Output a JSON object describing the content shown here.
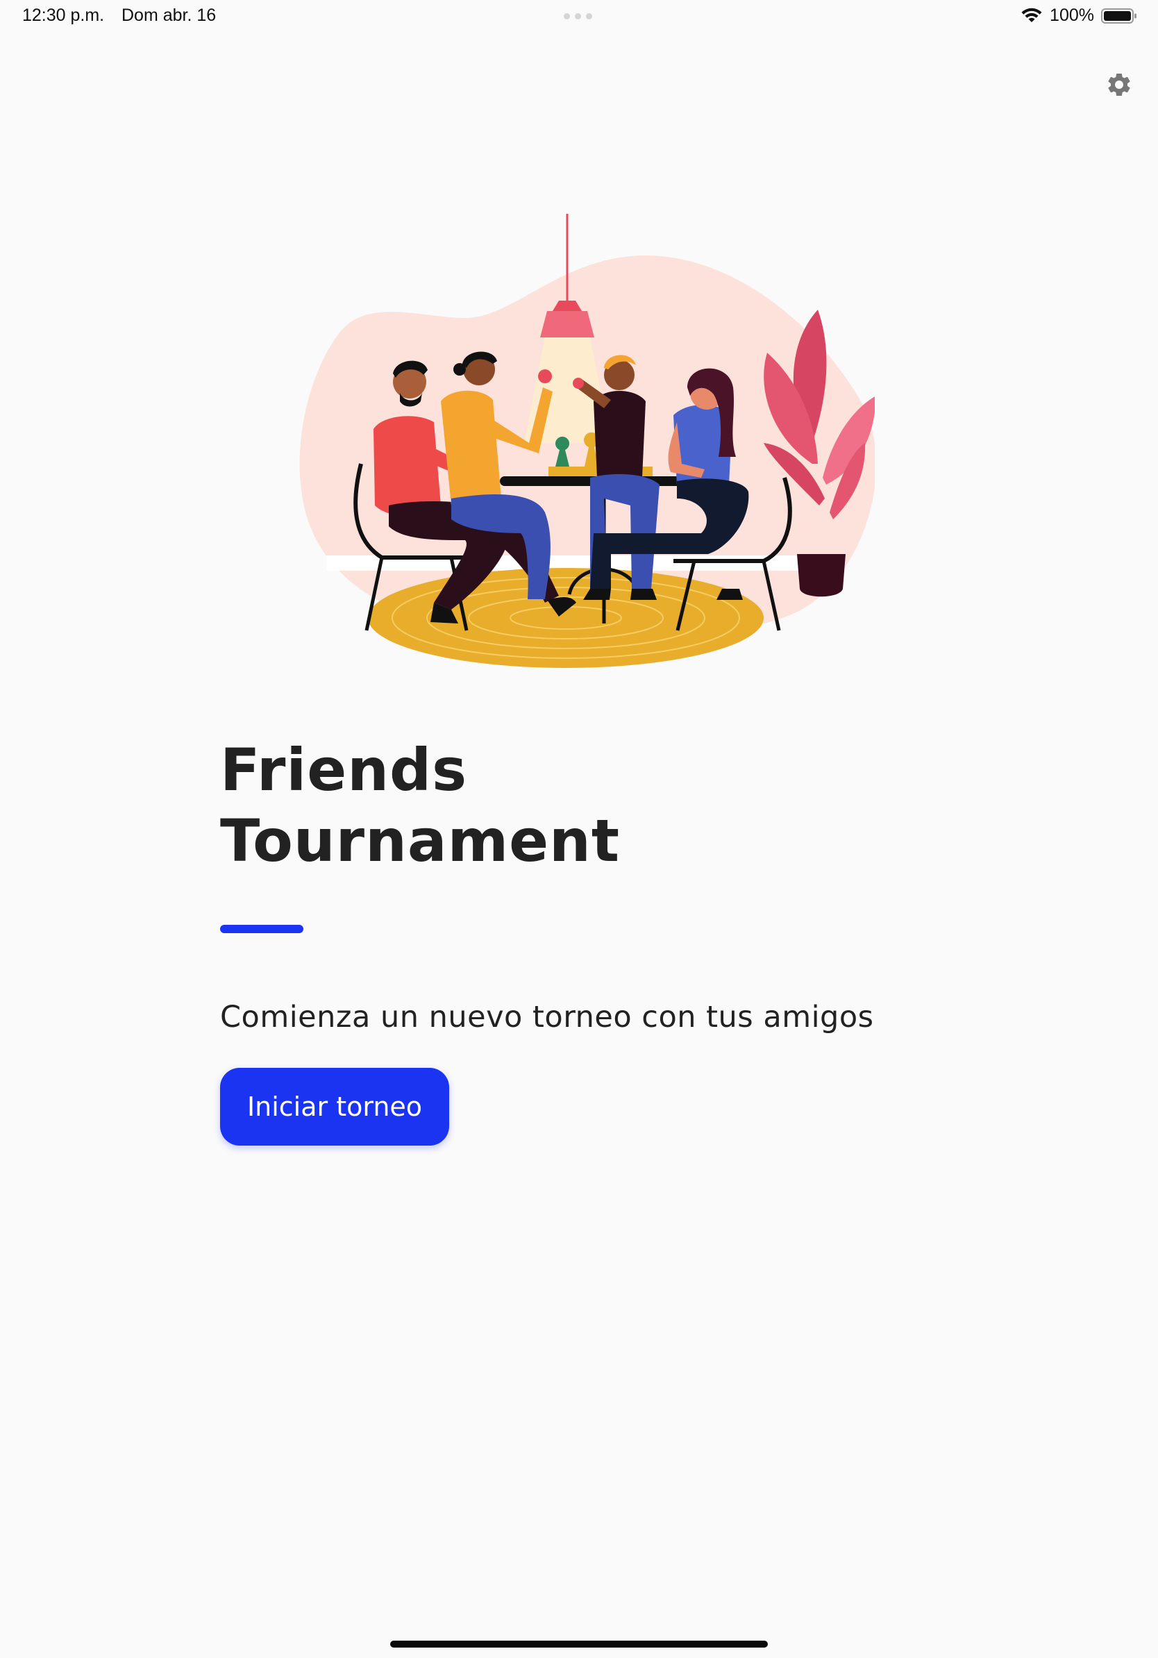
{
  "status_bar": {
    "time": "12:30 p.m.",
    "date": "Dom abr. 16",
    "battery_percent": "100%",
    "battery_level": 1.0,
    "icons": [
      "wifi-icon",
      "battery-icon"
    ]
  },
  "header": {
    "settings_icon": "gear-icon"
  },
  "hero": {
    "illustration": "friends-playing-board-game-illustration"
  },
  "main": {
    "title_line1": "Friends",
    "title_line2": "Tournament",
    "subtitle": "Comienza un nuevo torneo con tus amigos",
    "start_button_label": "Iniciar torneo"
  },
  "colors": {
    "accent": "#1b34f2",
    "background": "#fafafa",
    "text": "#222222"
  }
}
